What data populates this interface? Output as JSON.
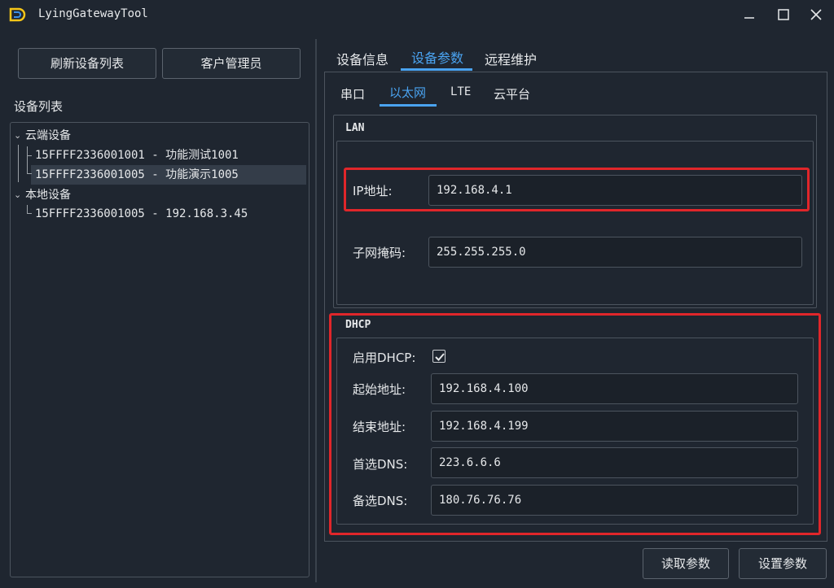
{
  "window": {
    "title": "LyingGatewayTool",
    "controls": [
      "minimize",
      "maximize",
      "close"
    ]
  },
  "left_pane": {
    "refresh_button": "刷新设备列表",
    "customer_button": "客户管理员",
    "device_list_label": "设备列表",
    "tree": [
      {
        "label": "云端设备",
        "expanded": true,
        "children": [
          {
            "label": "15FFFF2336001001 - 功能测试1001",
            "selected": false
          },
          {
            "label": "15FFFF2336001005 - 功能演示1005",
            "selected": true
          }
        ]
      },
      {
        "label": "本地设备",
        "expanded": true,
        "children": [
          {
            "label": "15FFFF2336001005 - 192.168.3.45",
            "selected": false
          }
        ]
      }
    ]
  },
  "tabs": {
    "items": [
      "设备信息",
      "设备参数",
      "远程维护"
    ],
    "active": "设备参数"
  },
  "sub_tabs": {
    "items": [
      "串口",
      "以太网",
      "LTE",
      "云平台"
    ],
    "active": "以太网"
  },
  "lan": {
    "title": "LAN",
    "ip_label": "IP地址:",
    "ip_value": "192.168.4.1",
    "mask_label": "子网掩码:",
    "mask_value": "255.255.255.0"
  },
  "dhcp": {
    "title": "DHCP",
    "enable_label": "启用DHCP:",
    "enabled": true,
    "start_label": "起始地址:",
    "start_value": "192.168.4.100",
    "end_label": "结束地址:",
    "end_value": "192.168.4.199",
    "dns1_label": "首选DNS:",
    "dns1_value": "223.6.6.6",
    "dns2_label": "备选DNS:",
    "dns2_value": "180.76.76.76"
  },
  "actions": {
    "read_button": "读取参数",
    "set_button": "设置参数"
  },
  "colors": {
    "background": "#1f2630",
    "accent": "#4aa3f0",
    "highlight_box": "#e0262a",
    "logo": "#f5c518"
  }
}
